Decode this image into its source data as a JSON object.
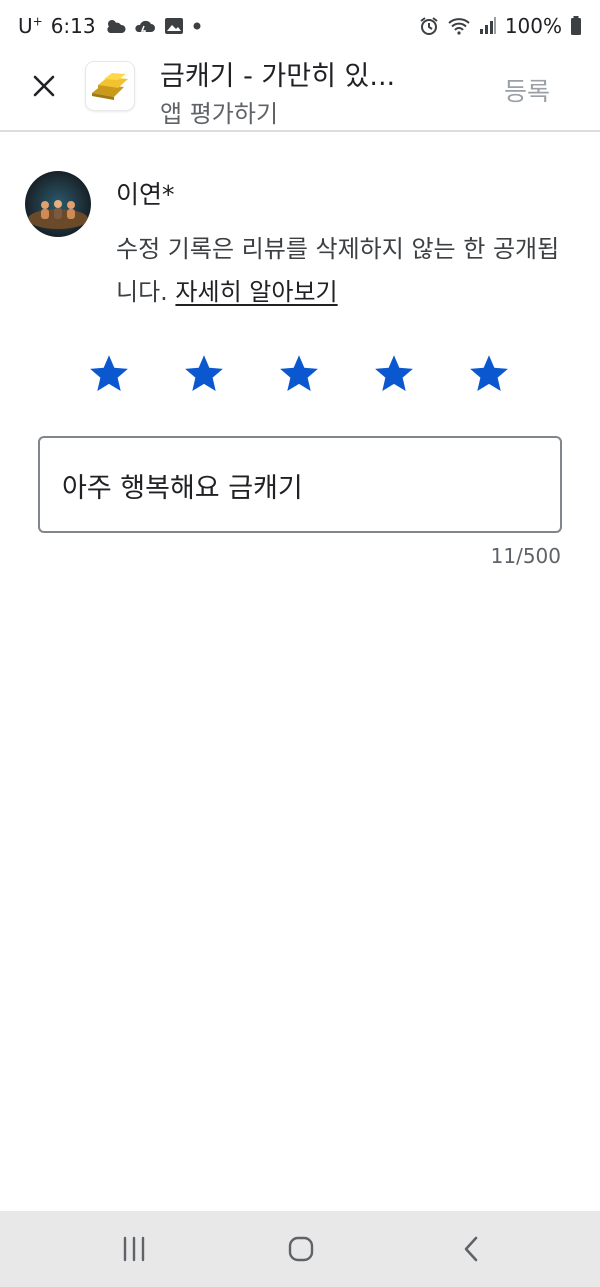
{
  "status_bar": {
    "carrier": "U",
    "carrier_sup": "+",
    "time": "6:13",
    "battery": "100%",
    "icons": [
      "weather-icon",
      "cloud-icon",
      "gallery-icon",
      "dot-icon",
      "alarm-icon",
      "wifi-icon",
      "signal-icon",
      "battery-icon"
    ]
  },
  "header": {
    "close_icon": "close-icon",
    "app_icon": "gold-bars-icon",
    "title": "금캐기 - 가만히 있...",
    "subtitle": "앱 평가하기",
    "submit_label": "등록"
  },
  "review": {
    "author_name": "이연*",
    "notice_text": "수정 기록은 리뷰를 삭제하지 않는 한 공개됩니다. ",
    "learn_more": "자세히 알아보기",
    "rating": 5,
    "rating_max": 5,
    "text": "아주 행복해요 금캐기",
    "counter": "11/500"
  },
  "colors": {
    "star": "#0b57d0",
    "submit_disabled": "#9aa0a6",
    "divider": "#dadce0",
    "nav_bg": "#e8e8e8"
  },
  "nav_bar": {
    "icons": [
      "recent-apps-icon",
      "home-icon",
      "back-icon"
    ]
  }
}
